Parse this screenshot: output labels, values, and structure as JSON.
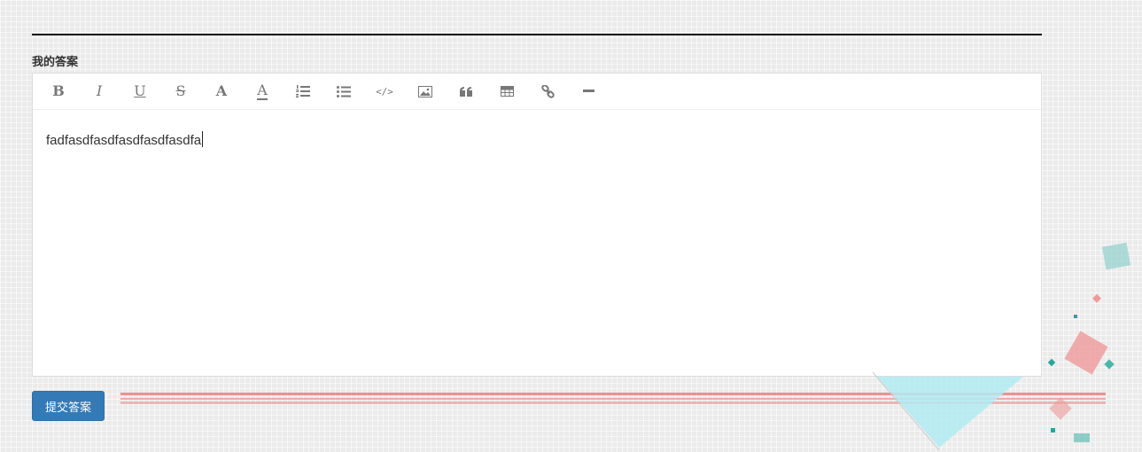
{
  "section_label": "我的答案",
  "toolbar": {
    "buttons": [
      {
        "name": "bold",
        "glyph": "B"
      },
      {
        "name": "italic",
        "glyph": "I"
      },
      {
        "name": "underline",
        "glyph": "U"
      },
      {
        "name": "strikethrough",
        "glyph": "S"
      },
      {
        "name": "font-size",
        "glyph": "A"
      },
      {
        "name": "font-color",
        "glyph": "A"
      },
      {
        "name": "ordered-list",
        "glyph": ""
      },
      {
        "name": "unordered-list",
        "glyph": ""
      },
      {
        "name": "code",
        "glyph": "</>"
      },
      {
        "name": "image",
        "glyph": ""
      },
      {
        "name": "blockquote",
        "glyph": ""
      },
      {
        "name": "table",
        "glyph": ""
      },
      {
        "name": "link",
        "glyph": ""
      },
      {
        "name": "horizontal-rule",
        "glyph": ""
      }
    ]
  },
  "editor": {
    "content": "fadfasdfasdfasdfasdfasdfa"
  },
  "submit_label": "提交答案",
  "colors": {
    "primary": "#337ab7",
    "deco_red": "#e57373",
    "deco_teal": "#4db6ac",
    "deco_cyan": "#b2ebf2"
  }
}
